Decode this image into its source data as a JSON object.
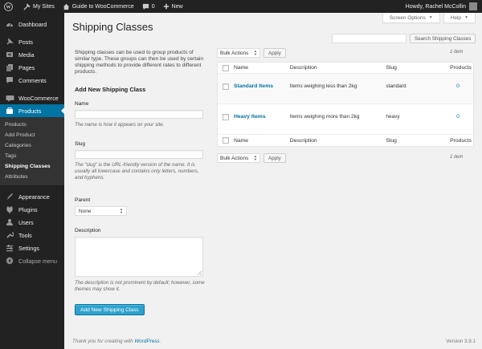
{
  "adminbar": {
    "my_sites": "My Sites",
    "site_name": "Guide to WooCommerce",
    "comments_count": "0",
    "new_label": "New",
    "greeting": "Howdy, Rachel McCollin"
  },
  "sidebar": {
    "items_top": [
      {
        "label": "Dashboard",
        "icon": "dashboard-icon"
      },
      {
        "label": "Posts",
        "icon": "pin-icon"
      },
      {
        "label": "Media",
        "icon": "media-icon"
      },
      {
        "label": "Pages",
        "icon": "pages-icon"
      },
      {
        "label": "Comments",
        "icon": "comments-icon"
      }
    ],
    "woocommerce": "WooCommerce",
    "products": "Products",
    "submenu": [
      "Products",
      "Add Product",
      "Categories",
      "Tags",
      "Shipping Classes",
      "Attributes"
    ],
    "items_bottom": [
      {
        "label": "Appearance",
        "icon": "appearance-icon"
      },
      {
        "label": "Plugins",
        "icon": "plugins-icon"
      },
      {
        "label": "Users",
        "icon": "users-icon"
      },
      {
        "label": "Tools",
        "icon": "tools-icon"
      },
      {
        "label": "Settings",
        "icon": "settings-icon"
      },
      {
        "label": "Collapse menu",
        "icon": "collapse-icon"
      }
    ],
    "accent_color": "#0074a2"
  },
  "screen_options": "Screen Options",
  "help": "Help",
  "page": {
    "title": "Shipping Classes",
    "intro": "Shipping classes can be used to group products of similar type. These groups can then be used by certain shipping methods to provide different rates to different products."
  },
  "search": {
    "button": "Search Shipping Classes",
    "value": ""
  },
  "form": {
    "heading": "Add New Shipping Class",
    "name_label": "Name",
    "name_help": "The name is how it appears on your site.",
    "slug_label": "Slug",
    "slug_help": "The “slug” is the URL-friendly version of the name. It is usually all lowercase and contains only letters, numbers, and hyphens.",
    "parent_label": "Parent",
    "parent_value": "None",
    "description_label": "Description",
    "description_help": "The description is not prominent by default; however, some themes may show it.",
    "submit": "Add New Shipping Class"
  },
  "table": {
    "bulk_actions": "Bulk Actions",
    "apply": "Apply",
    "count": "1 item",
    "columns": [
      "Name",
      "Description",
      "Slug",
      "Products"
    ],
    "rows": [
      {
        "name": "Standard Items",
        "description": "Items weighing less than 2kg",
        "slug": "standard",
        "products": "0"
      },
      {
        "name": "Heavy Items",
        "description": "Items weighing more than 2kg",
        "slug": "heavy",
        "products": "0"
      }
    ]
  },
  "footer": {
    "thanks_prefix": "Thank you for creating with ",
    "wordpress_link": "WordPress",
    "thanks_suffix": ".",
    "version": "Version 3.9.1"
  }
}
